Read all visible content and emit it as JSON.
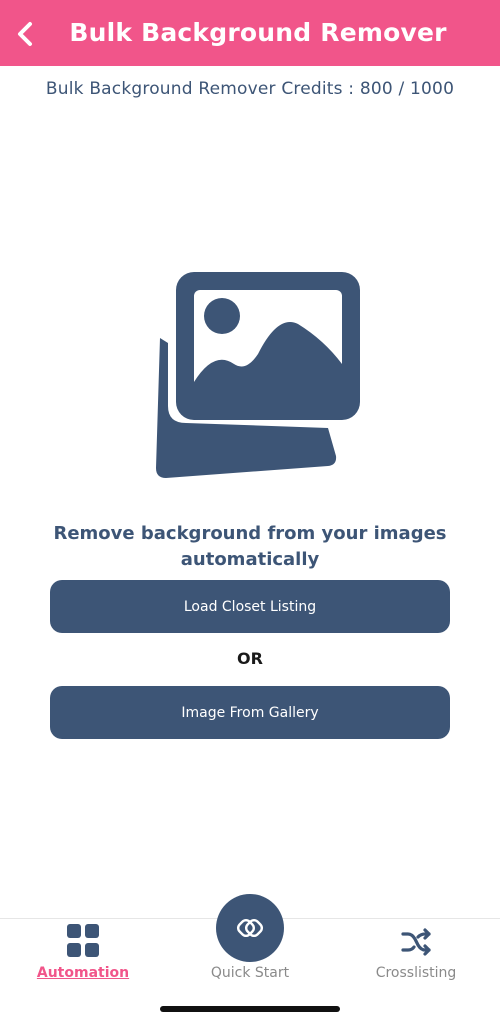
{
  "header": {
    "title": "Bulk Background Remover",
    "back_icon": "chevron-left-icon"
  },
  "credits_text": "Bulk Background Remover Credits : 800 / 1000",
  "illustration": {
    "icon": "image-gallery-icon",
    "color": "#3d5576"
  },
  "main": {
    "headline": "Remove background from your images automatically",
    "load_closet_label": "Load Closet Listing",
    "or_label": "OR",
    "gallery_label": "Image From Gallery"
  },
  "tabbar": {
    "items": [
      {
        "label": "Automation",
        "icon": "grid-icon",
        "active": true
      },
      {
        "label": "Quick Start",
        "icon": "quick-start-icon",
        "active": false
      },
      {
        "label": "Crosslisting",
        "icon": "shuffle-icon",
        "active": false
      }
    ]
  },
  "colors": {
    "header": "#f1558a",
    "primary": "#3d5576",
    "active_tab": "#f1558a",
    "inactive_tab": "#8a8a8a"
  }
}
